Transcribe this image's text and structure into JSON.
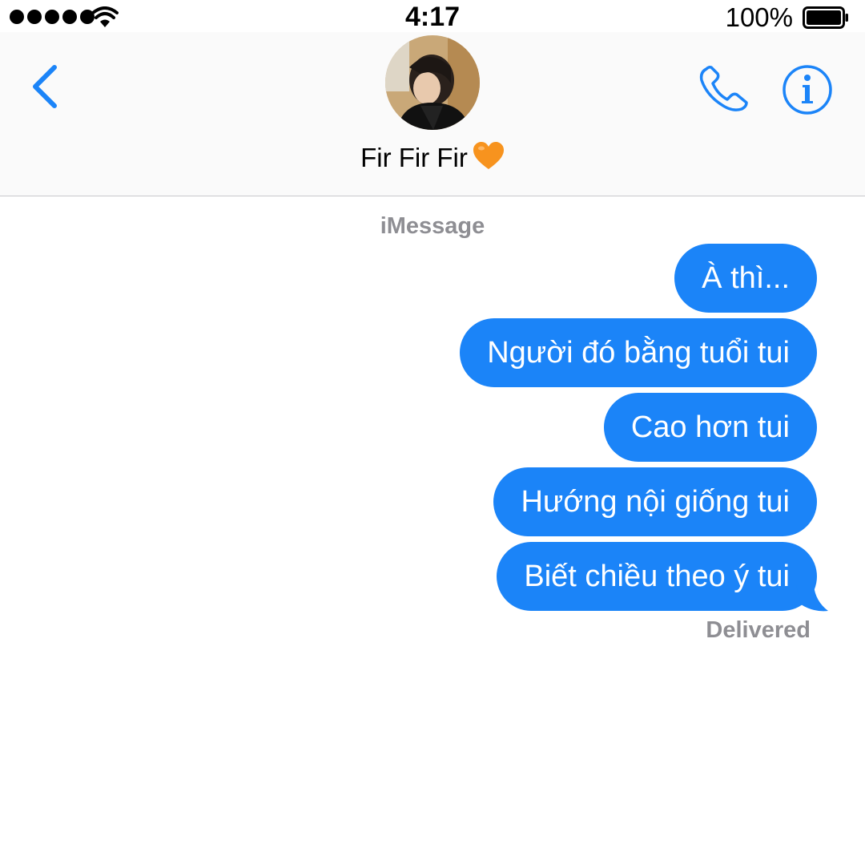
{
  "status_bar": {
    "time": "4:17",
    "battery_percent": "100%",
    "signal_icon": "signal-dots-icon",
    "wifi_icon": "wifi-icon",
    "battery_icon": "battery-full-icon"
  },
  "header": {
    "back_icon": "chevron-left-icon",
    "contact_name": "Fir Fir Fir",
    "contact_emoji": "orange-heart-icon",
    "call_icon": "phone-icon",
    "info_icon": "info-icon"
  },
  "thread": {
    "service_label": "iMessage",
    "messages": [
      {
        "text": "À thì..."
      },
      {
        "text": "Người đó bằng tuổi tui"
      },
      {
        "text": "Cao hơn tui"
      },
      {
        "text": "Hướng nội giống tui"
      },
      {
        "text": "Biết chiều theo ý tui"
      }
    ],
    "status": "Delivered"
  },
  "colors": {
    "accent": "#1b84f8",
    "bubble_text": "#ffffff",
    "secondary_text": "#8e8e93",
    "heart": "#f7931e"
  }
}
